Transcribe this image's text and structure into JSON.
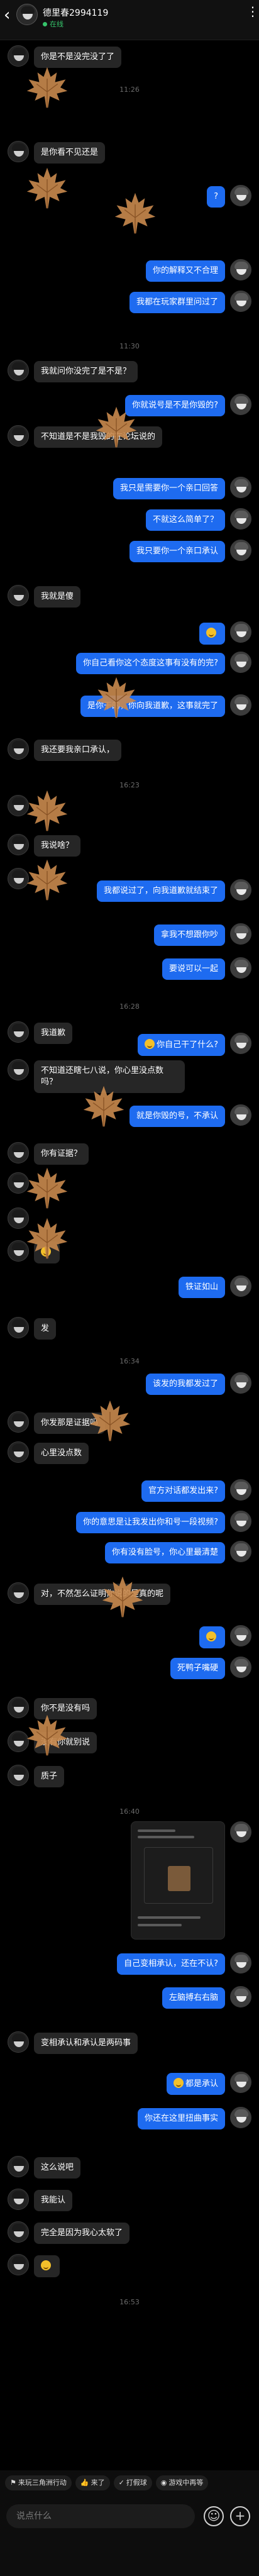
{
  "header": {
    "back_icon": "chevron-left-icon",
    "name": "德里春2994119",
    "status": "在线",
    "more_icon": "more-vertical-icon"
  },
  "messages": [
    {
      "id": "m1",
      "dir": "in",
      "text": "你是不是没完没了了"
    },
    {
      "id": "t1",
      "type": "time",
      "text": "11:26"
    },
    {
      "id": "m2",
      "dir": "in",
      "text": "是你看不见还是"
    },
    {
      "id": "m3",
      "dir": "out",
      "text": "?"
    },
    {
      "id": "m4",
      "dir": "out",
      "text": "你的解释又不合理"
    },
    {
      "id": "m5",
      "dir": "out",
      "text": "我都在玩家群里问过了"
    },
    {
      "id": "t2",
      "type": "time",
      "text": "11:30"
    },
    {
      "id": "m6",
      "dir": "in",
      "text": "我就问你没完了是不是？"
    },
    {
      "id": "m7",
      "dir": "out",
      "text": "你就说号是不是你毁的?"
    },
    {
      "id": "m8",
      "dir": "in",
      "text": "不知道是不是我毁的在论坛说的"
    },
    {
      "id": "m9",
      "dir": "out",
      "text": "我只是需要你一个亲口回答"
    },
    {
      "id": "m10",
      "dir": "out",
      "text": "不就这么简单了？"
    },
    {
      "id": "m11",
      "dir": "out",
      "text": "我只要你一个亲口承认"
    },
    {
      "id": "m12",
      "dir": "in",
      "text": "我就是傻"
    },
    {
      "id": "m13",
      "dir": "out",
      "text": "😅",
      "emoji": true
    },
    {
      "id": "m14",
      "dir": "out",
      "text": "你自己看你这个态度这事有没有的完?"
    },
    {
      "id": "m15",
      "dir": "out",
      "text": "是你干的，你向我道歉，这事就完了"
    },
    {
      "id": "m16",
      "dir": "in",
      "text": "我还要我亲口承认，"
    },
    {
      "id": "t3",
      "type": "time",
      "text": "16:23"
    },
    {
      "id": "m17",
      "dir": "in",
      "text": ""
    },
    {
      "id": "m18",
      "dir": "in",
      "text": "我说啥？"
    },
    {
      "id": "m19",
      "dir": "in",
      "text": ""
    },
    {
      "id": "m20",
      "dir": "out",
      "text": "我都说过了，向我道歉就结束了"
    },
    {
      "id": "m21",
      "dir": "out",
      "text": "拿我不想跟你吵"
    },
    {
      "id": "m22",
      "dir": "out",
      "text": "要说可以一起"
    },
    {
      "id": "t4",
      "type": "time",
      "text": "16:28"
    },
    {
      "id": "m23",
      "dir": "in",
      "text": "我道歉"
    },
    {
      "id": "m24",
      "dir": "out",
      "text": "你自己干了什么?",
      "emoji": true
    },
    {
      "id": "m25",
      "dir": "in",
      "text": "不知道还瞎七八说，你心里没点数吗？"
    },
    {
      "id": "m26",
      "dir": "out",
      "text": "就是你毁的号，不承认"
    },
    {
      "id": "m27",
      "dir": "in",
      "text": "你有证据？"
    },
    {
      "id": "m28",
      "dir": "in",
      "text": ""
    },
    {
      "id": "m29",
      "dir": "in",
      "text": ""
    },
    {
      "id": "m30",
      "dir": "in",
      "text": "😅",
      "emoji": true
    },
    {
      "id": "m31",
      "dir": "out",
      "text": "铁证如山"
    },
    {
      "id": "m32",
      "dir": "in",
      "text": "发"
    },
    {
      "id": "t5",
      "type": "time",
      "text": "16:34"
    },
    {
      "id": "m33",
      "dir": "out",
      "text": "该发的我都发过了"
    },
    {
      "id": "m34",
      "dir": "in",
      "text": "你发那是证据吗"
    },
    {
      "id": "m35",
      "dir": "in",
      "text": "心里没点数"
    },
    {
      "id": "m36",
      "dir": "out",
      "text": "官方对话都发出来?"
    },
    {
      "id": "m37",
      "dir": "out",
      "text": "你的意思是让我发出你和号一段视频?"
    },
    {
      "id": "m38",
      "dir": "out",
      "text": "你有没有脸号，你心里最清楚"
    },
    {
      "id": "m39",
      "dir": "in",
      "text": "对，不然怎么证明你说的是真的呢"
    },
    {
      "id": "m40",
      "dir": "out",
      "text": "😅",
      "emoji": true
    },
    {
      "id": "m41",
      "dir": "out",
      "text": "死鸭子嘴硬"
    },
    {
      "id": "m42",
      "dir": "in",
      "text": "你不是没有吗"
    },
    {
      "id": "m43",
      "dir": "in",
      "text": "没有你就别说"
    },
    {
      "id": "m44",
      "dir": "in",
      "text": "质子"
    },
    {
      "id": "t6",
      "type": "time",
      "text": "16:40"
    },
    {
      "id": "m45",
      "dir": "out",
      "type": "image"
    },
    {
      "id": "m46",
      "dir": "out",
      "text": "自己变相承认，还在不认?"
    },
    {
      "id": "m47",
      "dir": "out",
      "text": "左脑搏右右脑"
    },
    {
      "id": "m48",
      "dir": "in",
      "text": "变相承认和承认是两码事"
    },
    {
      "id": "m49",
      "dir": "out",
      "text": "都是承认",
      "emoji": true
    },
    {
      "id": "m50",
      "dir": "out",
      "text": "你还在这里扭曲事实"
    },
    {
      "id": "m51",
      "dir": "in",
      "text": "这么说吧"
    },
    {
      "id": "m52",
      "dir": "in",
      "text": "我能认"
    },
    {
      "id": "m53",
      "dir": "in",
      "text": "完全是因为我心太软了"
    },
    {
      "id": "m54",
      "dir": "in",
      "text": "😅",
      "emoji": true
    },
    {
      "id": "t7",
      "type": "time",
      "text": "16:53"
    }
  ],
  "quickbar": [
    {
      "icon": "flag-icon",
      "label": "来玩三角洲行动"
    },
    {
      "icon": "thumb-icon",
      "label": "来了"
    },
    {
      "icon": "game-icon",
      "label": "打假球"
    },
    {
      "icon": "controller-icon",
      "label": "游戏中再等"
    }
  ],
  "input": {
    "placeholder": "说点什么"
  },
  "colors": {
    "accent": "#1e6bf0",
    "incoming": "#262626",
    "background": "#000000",
    "leaf": "#c98a4e"
  }
}
